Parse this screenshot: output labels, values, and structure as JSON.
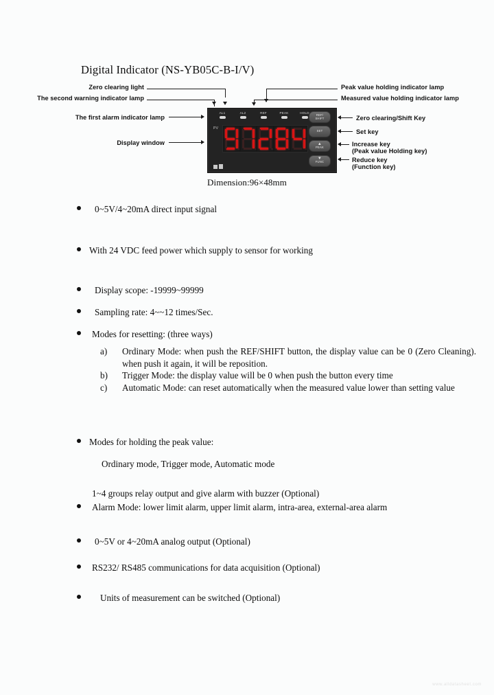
{
  "document": {
    "title": "Digital Indicator (NS-YB05C-B-I/V)",
    "dimension_caption": "Dimension:96×48mm"
  },
  "diagram": {
    "callouts_left": [
      {
        "label": "Zero clearing light"
      },
      {
        "label": "The second warning indicator lamp"
      },
      {
        "label": "The first alarm indicator lamp"
      },
      {
        "label": "Display window"
      }
    ],
    "callouts_right": [
      {
        "label": "Peak value holding indicator lamp"
      },
      {
        "label": "Measured value holding indicator lamp"
      },
      {
        "label": "Zero clearing/Shift Key"
      },
      {
        "label": "Set key"
      },
      {
        "label": "Increase key",
        "label2": "(Peak value Holding key)"
      },
      {
        "label": "Reduce key",
        "label2": "(Function key)"
      }
    ],
    "device": {
      "lamps": [
        {
          "label": "AL1"
        },
        {
          "label": "AL2"
        },
        {
          "label": "REF"
        },
        {
          "label": "PEAK"
        },
        {
          "label": "HOLD"
        }
      ],
      "pv_label": "PV",
      "display_value": "97284",
      "buttons": [
        {
          "line1": "REF/",
          "line2": "SHIFT",
          "glyph": ""
        },
        {
          "line1": "SET",
          "line2": "",
          "glyph": ""
        },
        {
          "line1": "",
          "line2": "PEAK",
          "glyph": "▲"
        },
        {
          "line1": "",
          "line2": "FUNC",
          "glyph": "▼"
        }
      ]
    }
  },
  "features": {
    "items": [
      {
        "text": "0~5V/4~20mA direct input signal"
      },
      {
        "text": "With 24 VDC feed power which supply to sensor for working"
      },
      {
        "text": "Display scope: -19999~99999"
      },
      {
        "text": "Sampling rate: 4~~12 times/Sec."
      },
      {
        "text": "Modes for resetting: (three ways)"
      },
      {
        "text": "Modes for holding the peak value:"
      },
      {
        "text": "Alarm Mode: lower limit alarm, upper limit alarm, intra-area, external-area alarm"
      },
      {
        "text": "0~5V or 4~20mA    analog output (Optional)"
      },
      {
        "text": "RS232/ RS485 communications for data acquisition (Optional)"
      },
      {
        "text": "Units of measurement can be switched (Optional)"
      }
    ],
    "reset_modes": [
      {
        "marker": "a)",
        "text": "Ordinary Mode: when push the REF/SHIFT button, the display value can be 0 (Zero Cleaning). when push it again, it will be reposition."
      },
      {
        "marker": "b)",
        "text": "Trigger Mode: the display value will be 0 when push the button every time"
      },
      {
        "marker": "c)",
        "text": "Automatic Mode: can reset automatically when the measured value lower than setting value"
      }
    ],
    "hold_modes_text": "Ordinary mode, Trigger mode, Automatic mode",
    "relay_text": "1~4 groups relay output and give alarm with buzzer (Optional)"
  },
  "watermark": {
    "text": "www.alldatasheet.com"
  }
}
